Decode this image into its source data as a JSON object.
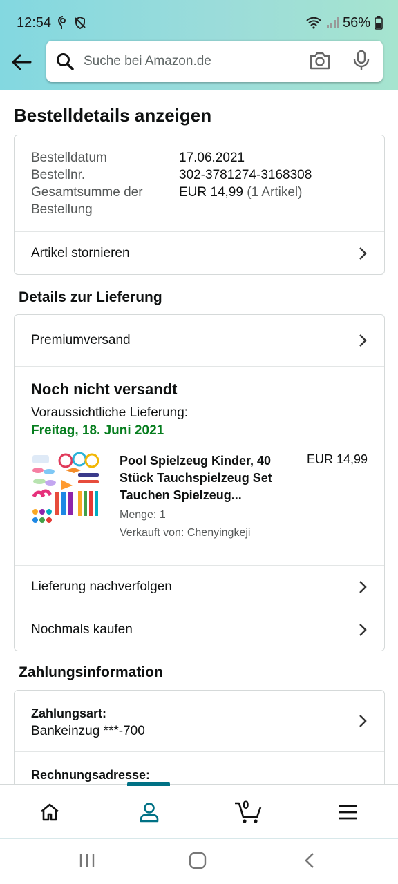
{
  "status_bar": {
    "time": "12:54",
    "battery": "56%"
  },
  "search": {
    "placeholder": "Suche bei Amazon.de"
  },
  "page": {
    "title": "Bestelldetails anzeigen"
  },
  "order": {
    "rows": [
      {
        "key": "Bestelldatum",
        "value": "17.06.2021"
      },
      {
        "key": "Bestellnr.",
        "value": "302-3781274-3168308"
      },
      {
        "key": "Gesamtsumme der Bestellung",
        "value": "EUR 14,99",
        "extra": "(1 Artikel)"
      }
    ],
    "cancel_label": "Artikel stornieren"
  },
  "delivery": {
    "heading": "Details zur Lieferung",
    "shipping_method": "Premiumversand",
    "status": "Noch nicht versandt",
    "estimate_label": "Voraussichtliche Lieferung:",
    "estimate_date": "Freitag, 18. Juni 2021",
    "item": {
      "title": "Pool Spielzeug Kinder, 40 Stück Tauchspielzeug Set Tauchen Spielzeug...",
      "price": "EUR 14,99",
      "quantity": "Menge: 1",
      "seller": "Verkauft von: Chenyingkeji"
    },
    "track_label": "Lieferung nachverfolgen",
    "buy_again_label": "Nochmals kaufen"
  },
  "payment": {
    "heading": "Zahlungsinformation",
    "method_label": "Zahlungsart:",
    "method_value": "Bankeinzug ***-700",
    "billing_label": "Rechnungsadresse:"
  },
  "bottom_nav": {
    "cart_count": "0"
  },
  "colors": {
    "accent": "#007185",
    "delivery_green": "#067d1e",
    "header_gradient_start": "#83d8e0",
    "header_gradient_end": "#a6e4cf"
  }
}
